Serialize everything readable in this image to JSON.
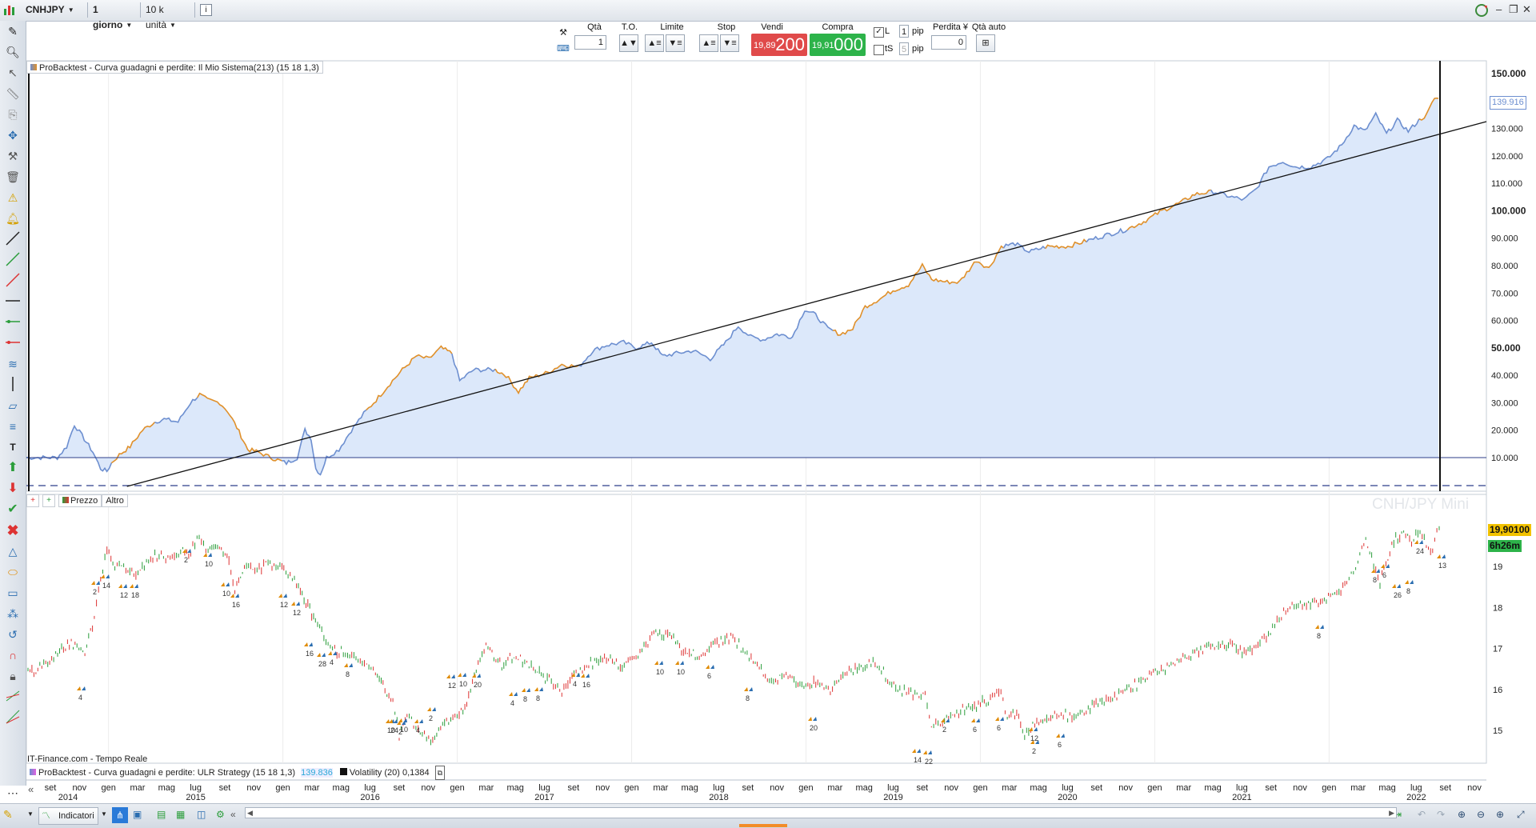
{
  "topbar": {
    "symbol": "CNHJPY",
    "timeframe": "1 giorno",
    "units": "10 k unità"
  },
  "trading": {
    "qty_label": "Qtà",
    "qty_value": "1",
    "to_label": "T.O.",
    "limit_label": "Limite",
    "stop_label": "Stop",
    "sell_label": "Vendi",
    "sell_small": "19,89",
    "sell_big": "200",
    "buy_label": "Compra",
    "buy_small": "19,91",
    "buy_big": "000",
    "l_label": "L",
    "l_value": "1",
    "pip1": "pip",
    "ts_label": "tS",
    "ts_value": "5",
    "pip2": "pip",
    "loss_label": "Perdita ¥",
    "loss_value": "0",
    "autoqty_label": "Qtà auto"
  },
  "upper_panel": {
    "legend": "ProBacktest - Curva guadagni e perdite: Il Mio Sistema(213) (15 18 1,3)",
    "current_value": "139.916",
    "y_labels": [
      "150.000",
      "140.000",
      "130.000",
      "120.000",
      "110.000",
      "100.000",
      "90.000",
      "80.000",
      "70.000",
      "60.000",
      "50.000",
      "40.000",
      "30.000",
      "20.000",
      "10.000"
    ],
    "bold_labels": [
      "150.000",
      "100.000",
      "50.000"
    ]
  },
  "lower_panel": {
    "tabs": [
      "Prezzo",
      "Altro"
    ],
    "watermark": "CNH/JPY Mini",
    "y_labels": [
      "19",
      "18",
      "17",
      "16",
      "15"
    ],
    "current_price": "19,90100",
    "countdown": "6h26m",
    "source_text": "IT-Finance.com - Tempo Reale",
    "legend_pnl": "ProBacktest - Curva guadagni e perdite: ULR Strategy (15 18 1,3)",
    "legend_pnl_value": "139.836",
    "legend_vol": "Volatility (20)",
    "legend_vol_value": "0,1384",
    "trade_labels": [
      "4",
      "2",
      "14",
      "12",
      "18",
      "2",
      "10",
      "10",
      "16",
      "12",
      "12",
      "16",
      "28",
      "4",
      "8",
      "10",
      "10",
      "24",
      "2",
      "4",
      "2",
      "12",
      "10",
      "20",
      "4",
      "8",
      "8",
      "4",
      "16",
      "10",
      "10",
      "6",
      "8",
      "20",
      "14",
      "22",
      "2",
      "6",
      "6",
      "2",
      "12",
      "6",
      "8",
      "8",
      "6",
      "26",
      "8",
      "24",
      "13"
    ]
  },
  "time_axis": {
    "months": [
      "set",
      "nov",
      "gen",
      "mar",
      "mag",
      "lug",
      "set",
      "nov",
      "gen",
      "mar",
      "mag",
      "lug",
      "set",
      "nov",
      "gen",
      "mar",
      "mag",
      "lug",
      "set",
      "nov",
      "gen",
      "mar",
      "mag",
      "lug",
      "set",
      "nov",
      "gen",
      "mar",
      "mag",
      "lug",
      "set",
      "nov",
      "gen",
      "mar",
      "mag",
      "lug",
      "set",
      "nov",
      "gen",
      "mar",
      "mag",
      "lug",
      "set",
      "nov",
      "gen",
      "mar",
      "mag",
      "lug",
      "set",
      "nov"
    ],
    "years": [
      "2014",
      "2015",
      "2016",
      "2017",
      "2018",
      "2019",
      "2020",
      "2021",
      "2022"
    ]
  },
  "bottombar": {
    "indicators_label": "Indicatori"
  },
  "colors": {
    "sell": "#e04a4a",
    "buy": "#2db34a",
    "equity_line": "#6d8fd0",
    "equity_fill": "#dce8fa",
    "price_tag": "#f2c200"
  }
}
